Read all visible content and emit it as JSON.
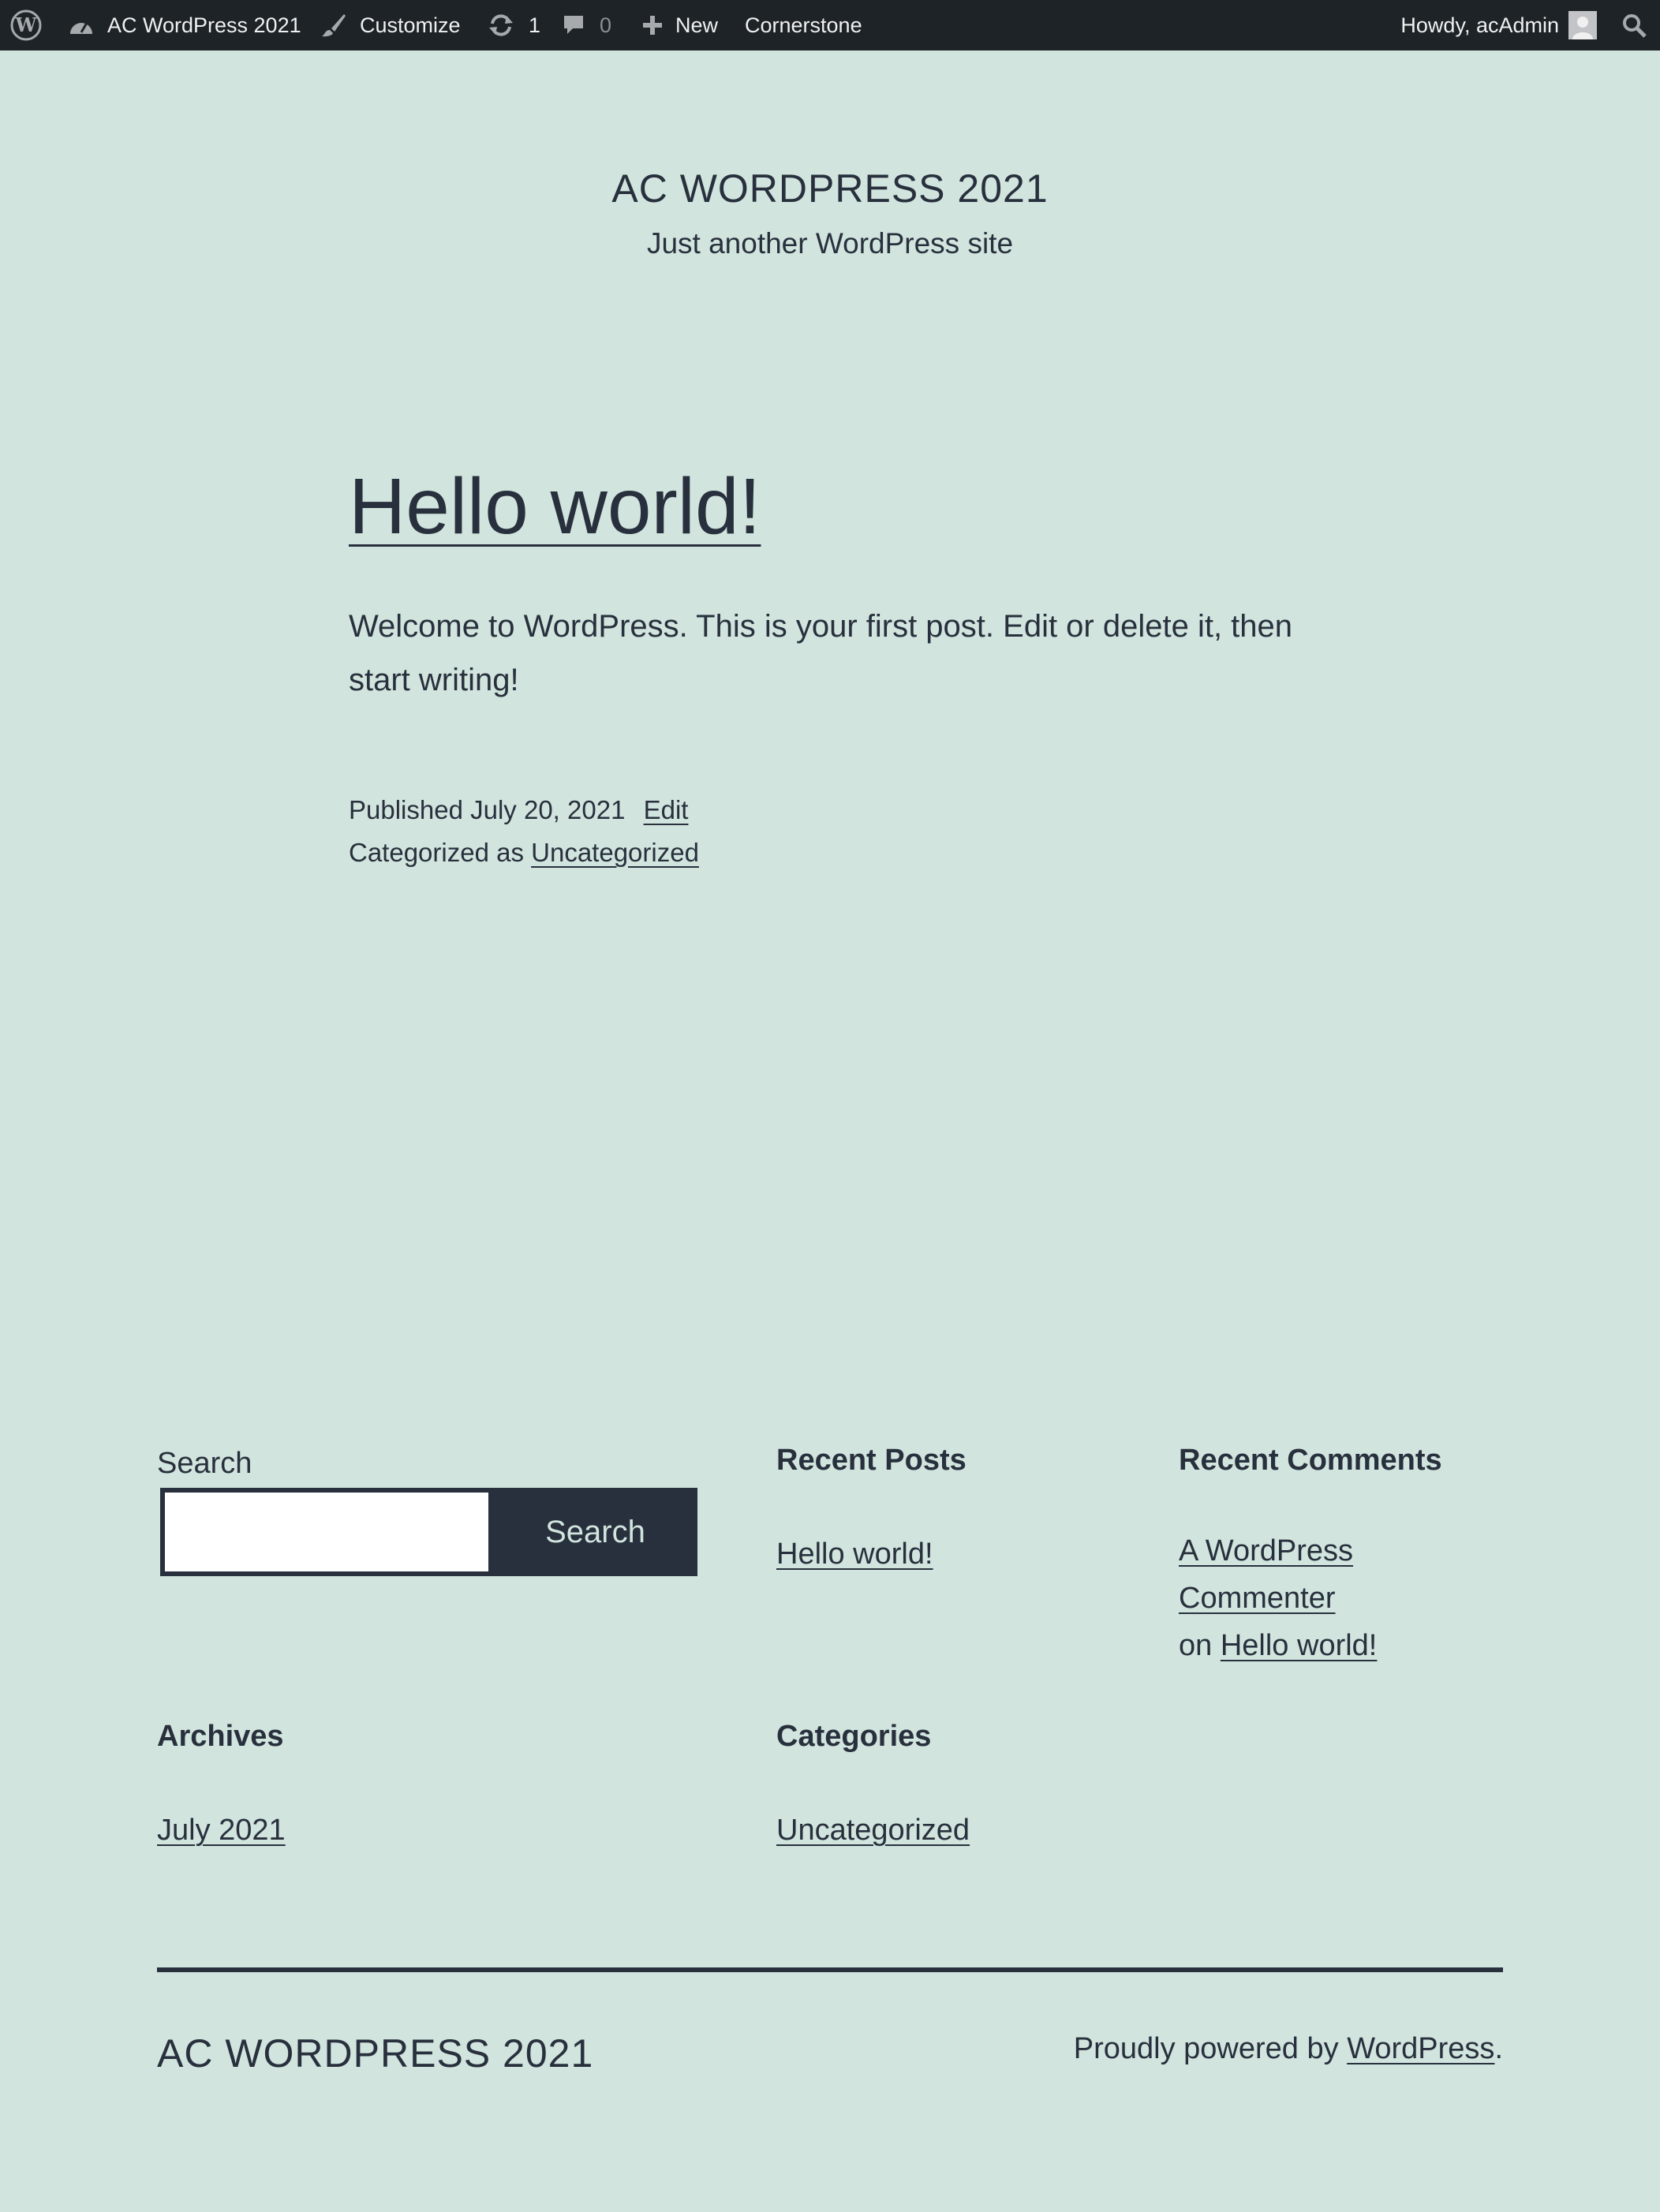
{
  "adminbar": {
    "wp_logo_icon": "wordpress-logo-icon",
    "site_name": "AC WordPress 2021",
    "customize": "Customize",
    "updates_count": "1",
    "comments_count": "0",
    "new_label": "New",
    "cornerstone": "Cornerstone",
    "howdy": "Howdy, acAdmin"
  },
  "header": {
    "title": "AC WORDPRESS 2021",
    "description": "Just another WordPress site"
  },
  "post": {
    "title": "Hello world!",
    "content": "Welcome to WordPress. This is your first post. Edit or delete it, then start writing!",
    "published_label": "Published July 20, 2021",
    "edit_label": "Edit",
    "categorized_label": "Categorized as",
    "category": "Uncategorized"
  },
  "widgets": {
    "search": {
      "label": "Search",
      "input_value": "",
      "button_label": "Search"
    },
    "recent_posts": {
      "title": "Recent Posts",
      "items": [
        "Hello world!"
      ]
    },
    "recent_comments": {
      "title": "Recent Comments",
      "author": "A WordPress Commenter",
      "on": "on",
      "post": "Hello world!"
    },
    "archives": {
      "title": "Archives",
      "items": [
        "July 2021"
      ]
    },
    "categories": {
      "title": "Categories",
      "items": [
        "Uncategorized"
      ]
    }
  },
  "footer": {
    "title": "AC WORDPRESS 2021",
    "powered_prefix": "Proudly powered by",
    "powered_link": "WordPress",
    "powered_suffix": "."
  },
  "colors": {
    "background": "#d1e4dd",
    "text": "#28303d",
    "adminbar": "#1d2327"
  }
}
